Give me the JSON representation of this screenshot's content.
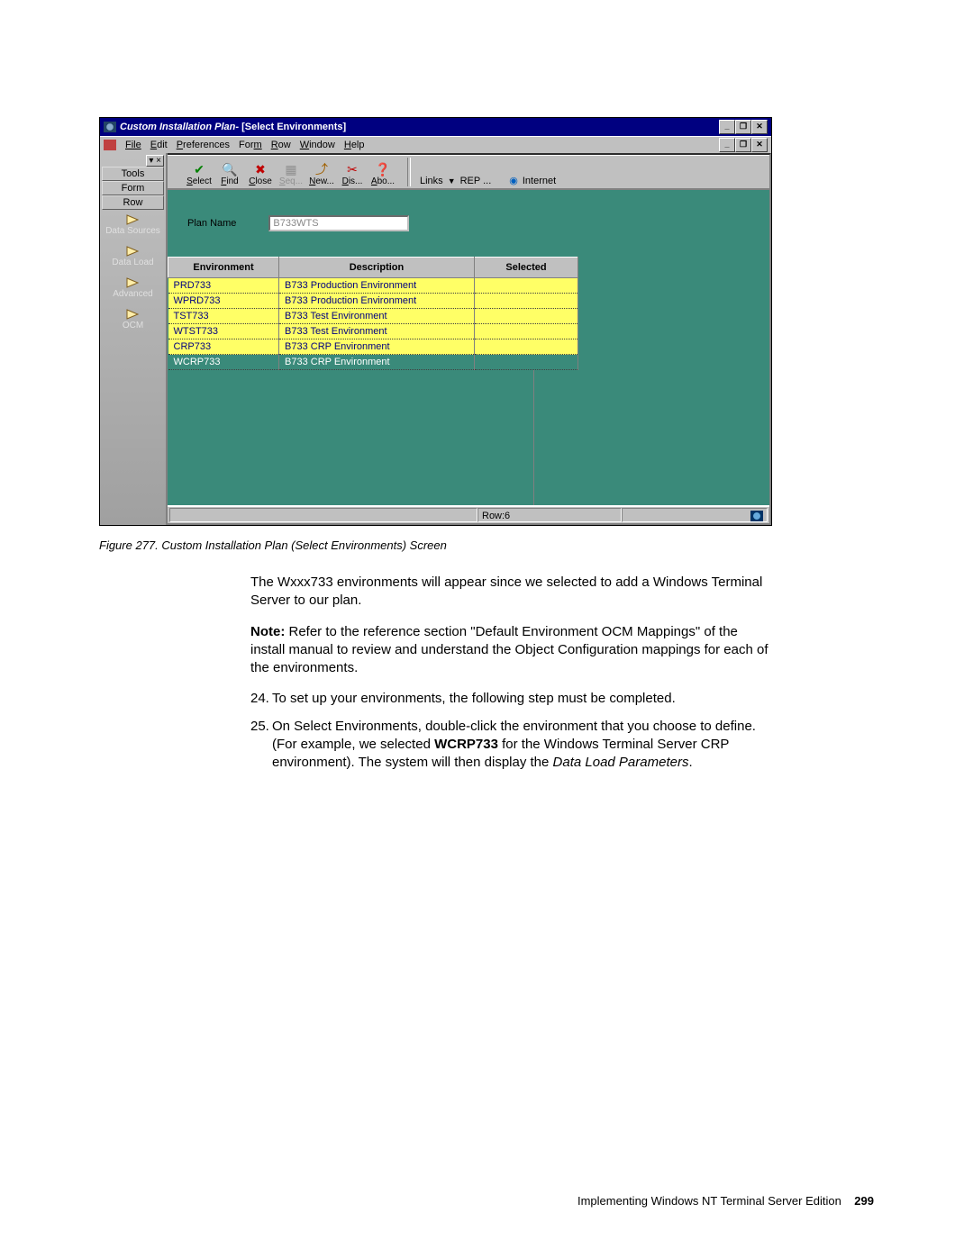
{
  "titlebar": {
    "app": "Custom Installation Plan",
    "sub": " - [Select Environments]"
  },
  "windowButtons": {
    "min": "_",
    "max": "❐",
    "close": "✕",
    "restore": "❐"
  },
  "menu": [
    "File",
    "Edit",
    "Preferences",
    "Form",
    "Row",
    "Window",
    "Help"
  ],
  "sidebar": {
    "handle": "▾ ×",
    "buttons": [
      "Tools",
      "Form",
      "Row"
    ],
    "items": [
      "Data Sources",
      "Data Load",
      "Advanced",
      "OCM"
    ]
  },
  "toolbar": {
    "items": [
      {
        "glyph": "✔",
        "label": "Select",
        "color": "#008000"
      },
      {
        "glyph": "🔍",
        "label": "Find",
        "color": "#000"
      },
      {
        "glyph": "✖",
        "label": "Close",
        "color": "#c00000"
      },
      {
        "glyph": "▦",
        "label": "Seq...",
        "color": "#909090",
        "disabled": true
      },
      {
        "glyph": "⤴",
        "label": "New...",
        "color": "#a06000"
      },
      {
        "glyph": "✂",
        "label": "Dis...",
        "color": "#c00000"
      },
      {
        "glyph": "❓",
        "label": "Abo...",
        "color": "#a06000"
      }
    ],
    "links": "Links",
    "rep": "REP ...",
    "internet": "Internet"
  },
  "plan": {
    "label": "Plan Name",
    "value": "B733WTS"
  },
  "grid": {
    "headers": [
      "Environment",
      "Description",
      "Selected"
    ],
    "rows": [
      {
        "env": "PRD733",
        "desc": "B733 Production Environment",
        "sel": "",
        "hl": false
      },
      {
        "env": "WPRD733",
        "desc": "B733 Production Environment",
        "sel": "",
        "hl": false
      },
      {
        "env": "TST733",
        "desc": "B733 Test Environment",
        "sel": "",
        "hl": false
      },
      {
        "env": "WTST733",
        "desc": "B733 Test Environment",
        "sel": "",
        "hl": false
      },
      {
        "env": "CRP733",
        "desc": "B733 CRP Environment",
        "sel": "",
        "hl": false
      },
      {
        "env": "WCRP733",
        "desc": "B733 CRP Environment",
        "sel": "",
        "hl": true
      }
    ]
  },
  "status": {
    "row": "Row:6"
  },
  "caption": "Figure 277. Custom Installation Plan (Select Environments) Screen",
  "para1": "The Wxxx733 environments will appear since we selected to add a Windows Terminal Server to our plan.",
  "noteLabel": "Note:",
  "noteBody": " Refer to the reference section \"Default Environment OCM Mappings\" of the install manual to review and understand the Object Configuration mappings for each of the environments.",
  "step24": {
    "n": "24.",
    "t": "To set up your environments, the following step must be completed."
  },
  "step25": {
    "n": "25.",
    "t1": "On Select Environments, double-click the environment that you choose to define. (For example, we selected ",
    "bold": "WCRP733",
    "t2": " for the Windows Terminal Server CRP environment). The system will then display the ",
    "ital": "Data Load Parameters",
    "t3": "."
  },
  "footer": {
    "text": "Implementing Windows NT Terminal Server Edition",
    "page": "299"
  }
}
